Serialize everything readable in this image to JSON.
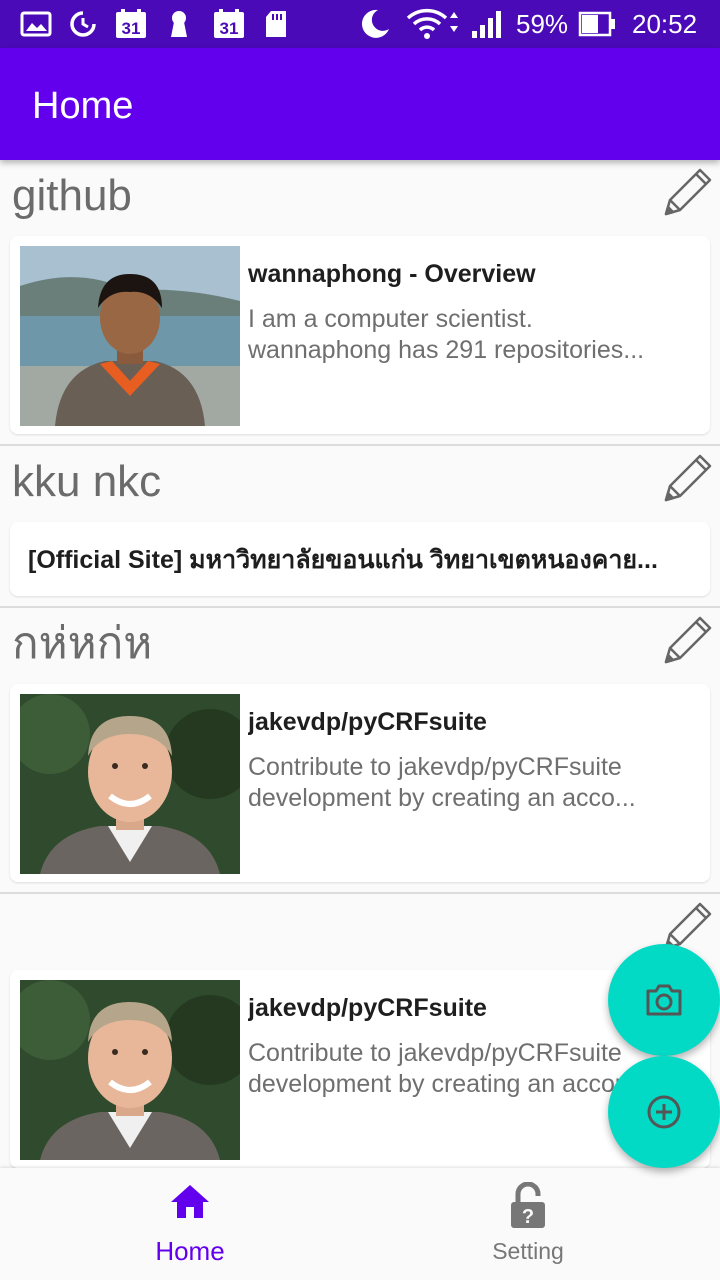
{
  "status_bar": {
    "battery": "59%",
    "time": "20:52",
    "calendar_day": "31"
  },
  "app_bar": {
    "title": "Home"
  },
  "sections": [
    {
      "title": "github",
      "card": {
        "title": "wannaphong - Overview",
        "desc_line1": "I am a computer scientist.",
        "desc_line2": "wannaphong has 291 repositories..."
      }
    },
    {
      "title": "kku nkc",
      "card": {
        "title": "[Official Site] มหาวิทยาลัยขอนแก่น วิทยาเขตหนองคาย..."
      }
    },
    {
      "title": "กห่หก่ห",
      "card": {
        "title": "jakevdp/pyCRFsuite",
        "desc_line1": "Contribute to jakevdp/pyCRFsuite",
        "desc_line2": "development by creating an acco..."
      }
    },
    {
      "title": "",
      "card": {
        "title": "jakevdp/pyCRFsuite",
        "desc_line1": "Contribute to jakevdp/pyCRFsuite",
        "desc_line2": "development by creating an account..."
      }
    }
  ],
  "fabs": {
    "camera": "camera-icon",
    "add": "add-circle-icon"
  },
  "bottom_nav": {
    "items": [
      {
        "label": "Home",
        "icon": "home-icon",
        "active": true
      },
      {
        "label": "Setting",
        "icon": "lock-question-icon",
        "active": false
      }
    ]
  },
  "colors": {
    "primary": "#6200ee",
    "status_bar": "#4a0ab8",
    "accent": "#03dac5",
    "nav_active": "#6200ee",
    "nav_inactive": "#777777"
  }
}
